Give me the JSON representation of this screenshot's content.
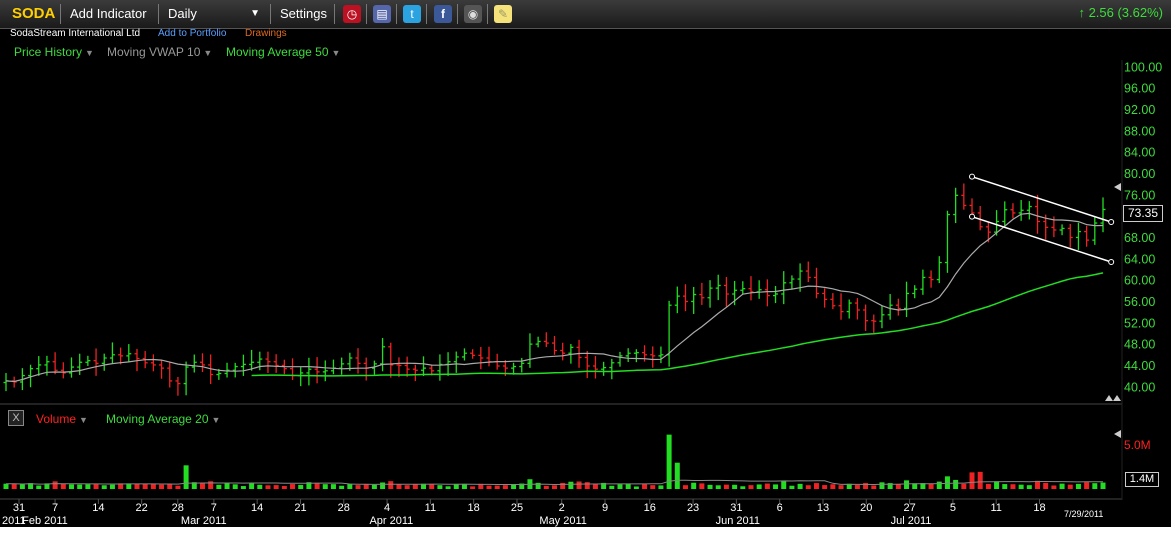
{
  "toolbar": {
    "symbol": "SODA",
    "add_indicator": "Add Indicator",
    "interval": "Daily",
    "interval_caret": "▼",
    "settings": "Settings",
    "change": "2.56 (3.62%)",
    "change_arrow": "↑",
    "icons": [
      "alarm-clock-icon",
      "book-icon",
      "twitter-icon",
      "facebook-icon",
      "camera-icon",
      "note-icon"
    ]
  },
  "company": {
    "name": "SodaStream International Ltd",
    "add_portfolio": "Add to Portfolio",
    "drawings": "Drawings"
  },
  "indicators": {
    "price_history": "Price History",
    "vwap": "Moving VWAP 10",
    "ma50": "Moving Average 50",
    "volume": "Volume",
    "ma20": "Moving Average 20",
    "close_x": "X"
  },
  "readouts": {
    "last_price": "73.35",
    "last_volume": "1.4M",
    "date": "7/29/2011"
  },
  "colors": {
    "up": "#22dd22",
    "down": "#ee2222",
    "vwap": "#aaaaaa",
    "ma": "#22dd22",
    "channel": "#ffffff"
  },
  "chart_data": [
    {
      "type": "candlestick",
      "title": "SODA",
      "y_ticks": [
        "40.00",
        "44.00",
        "48.00",
        "52.00",
        "56.00",
        "60.00",
        "64.00",
        "68.00",
        "72.00",
        "76.00",
        "80.00",
        "84.00",
        "88.00",
        "92.00",
        "96.00",
        "100.00"
      ],
      "ylim": [
        38,
        101
      ],
      "x_ticks": [
        "31",
        "7",
        "14",
        "22",
        "28",
        "7",
        "14",
        "21",
        "28",
        "4",
        "11",
        "18",
        "25",
        "2",
        "9",
        "16",
        "23",
        "31",
        "6",
        "13",
        "20",
        "27",
        "5",
        "11",
        "18"
      ],
      "month_labels": [
        "2011",
        "Feb 2011",
        "Mar 2011",
        "Apr 2011",
        "May 2011",
        "Jun 2011",
        "Jul 2011"
      ],
      "series": [
        {
          "name": "Price History",
          "close": [
            41.2,
            41.0,
            42.2,
            43.5,
            44.2,
            44.8,
            43.2,
            42.7,
            43.8,
            44.7,
            45.0,
            44.5,
            45.5,
            46.1,
            45.9,
            46.3,
            45.4,
            44.6,
            44.2,
            43.6,
            41.2,
            40.7,
            43.8,
            44.7,
            44.2,
            42.4,
            42.6,
            43.2,
            43.9,
            44.3,
            44.7,
            45.3,
            44.8,
            44.1,
            43.5,
            42.2,
            42.7,
            43.4,
            42.9,
            43.1,
            43.6,
            44.4,
            45.5,
            44.5,
            43.6,
            44.4,
            47.6,
            44.2,
            44.1,
            43.4,
            43.2,
            43.6,
            43.1,
            44.3,
            44.8,
            45.7,
            46.4,
            46.0,
            45.5,
            44.8,
            44.0,
            43.6,
            43.9,
            44.5,
            48.1,
            48.6,
            48.3,
            46.9,
            46.4,
            47.5,
            45.6,
            44.0,
            43.4,
            43.7,
            44.6,
            45.9,
            46.4,
            46.5,
            46.1,
            45.9,
            46.1,
            55.4,
            57.1,
            56.1,
            57.4,
            56.8,
            58.6,
            59.1,
            57.5,
            58.2,
            58.5,
            57.9,
            58.3,
            57.2,
            57.5,
            59.6,
            60.3,
            61.8,
            60.6,
            57.6,
            56.5,
            55.3,
            54.2,
            55.8,
            54.5,
            52.5,
            52.4,
            53.6,
            55.4,
            54.8,
            57.6,
            58.4,
            60.6,
            60.2,
            63.4,
            72.4,
            76.0,
            74.1,
            72.7,
            70.1,
            69.1,
            71.1,
            73.3,
            72.7,
            73.2,
            73.9,
            71.1,
            70.0,
            69.5,
            69.8,
            68.1,
            69.2,
            67.6,
            70.8,
            73.35
          ]
        },
        {
          "name": "Moving VWAP 10"
        },
        {
          "name": "Moving Average 50"
        }
      ],
      "channel": {
        "upper": [
          [
            118,
            79.5
          ],
          [
            135,
            71
          ]
        ],
        "lower": [
          [
            118,
            72
          ],
          [
            135,
            63.5
          ]
        ]
      }
    },
    {
      "type": "bar",
      "title": "Volume",
      "y_ticks": [
        "5.0M"
      ],
      "last": "1.4M",
      "series": [
        {
          "name": "Volume"
        },
        {
          "name": "Moving Average 20"
        }
      ]
    }
  ]
}
